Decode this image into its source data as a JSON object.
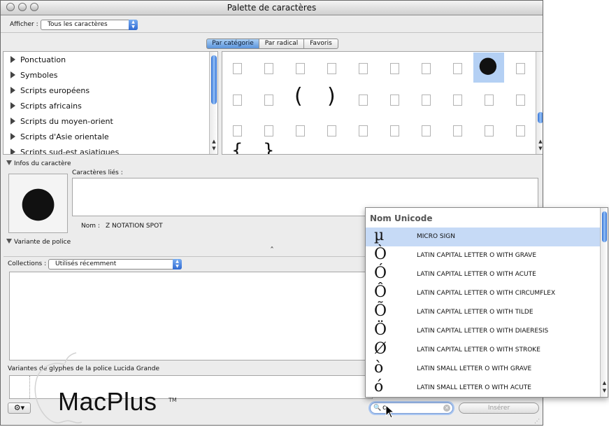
{
  "window": {
    "title": "Palette de caractères"
  },
  "toolbar": {
    "show_label": "Afficher :",
    "show_value": "Tous les caractères"
  },
  "tabs": [
    {
      "label": "Par catégorie",
      "active": true
    },
    {
      "label": "Par radical",
      "active": false
    },
    {
      "label": "Favoris",
      "active": false
    }
  ],
  "categories": [
    "Ponctuation",
    "Symboles",
    "Scripts européens",
    "Scripts africains",
    "Scripts du moyen-orient",
    "Scripts d'Asie orientale",
    "Scripts sud-est asiatiques"
  ],
  "grid": {
    "selected_glyph": "●",
    "glyphs": [
      "(",
      ")",
      "{",
      "}"
    ]
  },
  "info": {
    "section_label": "Infos du caractère",
    "preview_glyph": "●",
    "related_label": "Caractères liés :",
    "name_label": "Nom :",
    "name_value": "Z NOTATION SPOT"
  },
  "font_variant": {
    "section_label": "Variante de police",
    "expand_glyph": "ˆ"
  },
  "collections": {
    "label": "Collections :",
    "value": "Utilisés récemment"
  },
  "glyph_variants": {
    "label": "Variantes de glyphes de la police",
    "font": "Lucida Grande"
  },
  "logo": {
    "text": "MacPlus",
    "tm": "TM"
  },
  "bottom": {
    "search_value": "o",
    "insert_label": "Insérer"
  },
  "dropdown": {
    "header": "Nom Unicode",
    "rows": [
      {
        "glyph": "µ",
        "name": "MICRO SIGN",
        "selected": true
      },
      {
        "glyph": "Ò",
        "name": "LATIN CAPITAL LETTER O WITH GRAVE"
      },
      {
        "glyph": "Ó",
        "name": "LATIN CAPITAL LETTER O WITH ACUTE"
      },
      {
        "glyph": "Ô",
        "name": "LATIN CAPITAL LETTER O WITH CIRCUMFLEX"
      },
      {
        "glyph": "Õ",
        "name": "LATIN CAPITAL LETTER O WITH TILDE"
      },
      {
        "glyph": "Ö",
        "name": "LATIN CAPITAL LETTER O WITH DIAERESIS"
      },
      {
        "glyph": "Ø",
        "name": "LATIN CAPITAL LETTER O WITH STROKE"
      },
      {
        "glyph": "ò",
        "name": "LATIN SMALL LETTER O WITH GRAVE"
      },
      {
        "glyph": "ó",
        "name": "LATIN SMALL LETTER O WITH ACUTE"
      }
    ]
  }
}
